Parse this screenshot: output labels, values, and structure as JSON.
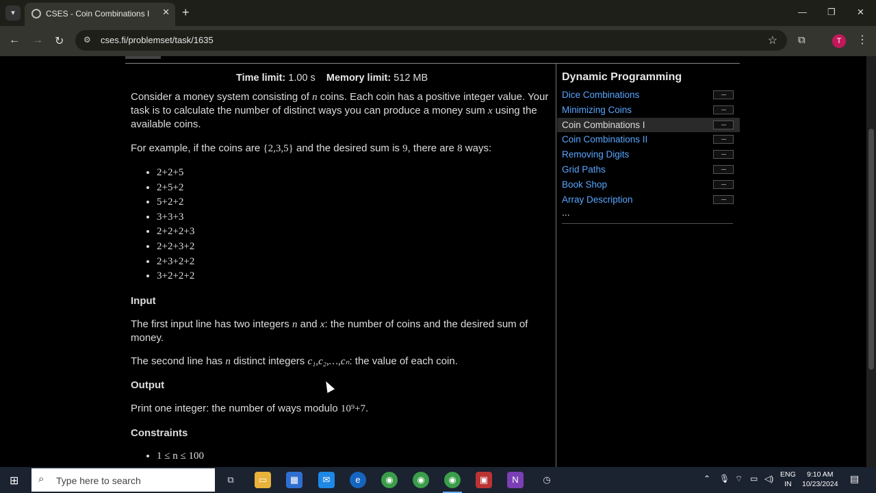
{
  "browser": {
    "tab_title": "CSES - Coin Combinations I",
    "url": "cses.fi/problemset/task/1635",
    "profile_initial": "T"
  },
  "problem": {
    "time_limit_label": "Time limit:",
    "time_limit_value": "1.00 s",
    "memory_limit_label": "Memory limit:",
    "memory_limit_value": "512 MB",
    "intro_1": "Consider a money system consisting of ",
    "intro_n": "n",
    "intro_2": " coins. Each coin has a positive integer value. Your task is to calculate the number of distinct ways you can produce a money sum ",
    "intro_x": "x",
    "intro_3": " using the available coins.",
    "example_1": "For example, if the coins are ",
    "example_set": "{2,3,5}",
    "example_2": " and the desired sum is ",
    "example_sum": "9",
    "example_3": ", there are ",
    "example_count": "8",
    "example_4": " ways:",
    "ways": [
      "2+2+5",
      "2+5+2",
      "5+2+2",
      "3+3+3",
      "2+2+2+3",
      "2+2+3+2",
      "2+3+2+2",
      "3+2+2+2"
    ],
    "input_heading": "Input",
    "input_1a": "The first input line has two integers ",
    "input_1n": "n",
    "input_1b": " and ",
    "input_1x": "x",
    "input_1c": ": the number of coins and the desired sum of money.",
    "input_2a": "The second line has ",
    "input_2n": "n",
    "input_2b": " distinct integers ",
    "input_2c": "c₁,c₂,…,cₙ",
    "input_2d": ": the value of each coin.",
    "output_heading": "Output",
    "output_1": "Print one integer: the number of ways modulo ",
    "output_mod": "10⁹+7",
    "output_2": ".",
    "constraints_heading": "Constraints",
    "constraint_1": "1 ≤ n ≤ 100"
  },
  "sidebar": {
    "title": "Dynamic Programming",
    "items": [
      {
        "label": "Dice Combinations"
      },
      {
        "label": "Minimizing Coins"
      },
      {
        "label": "Coin Combinations I"
      },
      {
        "label": "Coin Combinations II"
      },
      {
        "label": "Removing Digits"
      },
      {
        "label": "Grid Paths"
      },
      {
        "label": "Book Shop"
      },
      {
        "label": "Array Description"
      }
    ],
    "more": "..."
  },
  "taskbar": {
    "search_placeholder": "Type here to search",
    "lang_top": "ENG",
    "lang_bottom": "IN",
    "time": "9:10 AM",
    "date": "10/23/2024"
  },
  "colors": {
    "link": "#59a6ff",
    "page_bg": "#000000"
  }
}
